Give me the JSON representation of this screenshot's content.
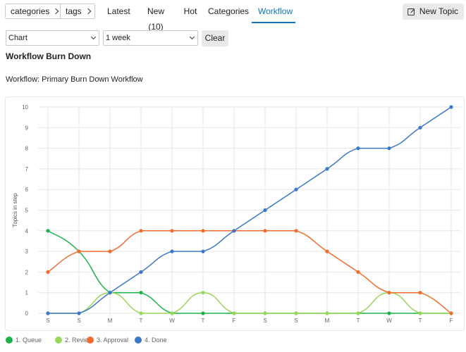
{
  "nav": {
    "categories_label": "categories",
    "tags_label": "tags",
    "tabs": [
      {
        "label": "Latest",
        "active": false
      },
      {
        "label": "New (10)",
        "active": false
      },
      {
        "label": "Hot",
        "active": false
      },
      {
        "label": "Categories",
        "active": false
      },
      {
        "label": "Workflow",
        "active": true
      }
    ],
    "new_topic_label": "New Topic"
  },
  "filters": {
    "view_select": "Chart",
    "period_select": "1 week",
    "clear_label": "Clear"
  },
  "heading": "Workflow Burn Down",
  "workflow_line": "Workflow: Primary Burn Down Workflow",
  "colors": {
    "accent": "#0e76bd",
    "queue": "#1db34b",
    "review": "#9bd65c",
    "approval": "#f26d2d",
    "done": "#3a78c9"
  },
  "chart_data": {
    "type": "line",
    "title": "",
    "xlabel": "",
    "ylabel": "Topics in step",
    "ylim": [
      0,
      10
    ],
    "yticks": [
      0,
      1,
      2,
      3,
      4,
      5,
      6,
      7,
      8,
      9,
      10
    ],
    "categories": [
      "S",
      "S",
      "M",
      "T",
      "W",
      "T",
      "F",
      "S",
      "S",
      "M",
      "T",
      "W",
      "T",
      "F"
    ],
    "grid": true,
    "legend_position": "bottom-left",
    "series": [
      {
        "name": "1. Queue",
        "color": "#1db34b",
        "values": [
          4,
          3,
          1,
          1,
          0,
          0,
          0,
          0,
          0,
          0,
          0,
          0,
          0,
          0
        ]
      },
      {
        "name": "2. Review",
        "color": "#9bd65c",
        "values": [
          0,
          0,
          1,
          0,
          0,
          1,
          0,
          0,
          0,
          0,
          0,
          1,
          0,
          0
        ]
      },
      {
        "name": "3. Approval",
        "color": "#f26d2d",
        "values": [
          2,
          3,
          3,
          4,
          4,
          4,
          4,
          4,
          4,
          3,
          2,
          1,
          1,
          0
        ]
      },
      {
        "name": "4. Done",
        "color": "#3a78c9",
        "values": [
          0,
          0,
          1,
          2,
          3,
          3,
          4,
          5,
          6,
          7,
          8,
          8,
          9,
          10
        ]
      }
    ]
  }
}
